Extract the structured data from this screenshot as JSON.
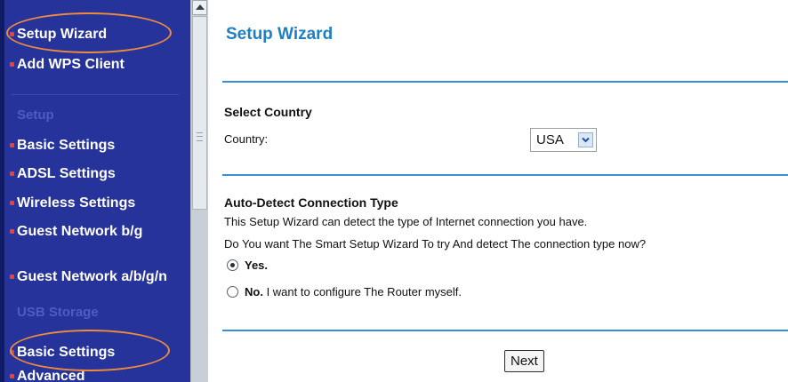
{
  "sidebar": {
    "top_items": [
      {
        "label": "Setup Wizard"
      },
      {
        "label": "Add WPS Client"
      }
    ],
    "setup_heading": "Setup",
    "setup_items": [
      {
        "label": "Basic Settings"
      },
      {
        "label": "ADSL Settings"
      },
      {
        "label": "Wireless Settings"
      },
      {
        "label": "Guest Network b/g"
      },
      {
        "label": "Guest Network a/b/g/n"
      }
    ],
    "usb_heading": "USB Storage",
    "usb_items": [
      {
        "label": "Basic Settings"
      },
      {
        "label": "Advanced"
      }
    ]
  },
  "main": {
    "title": "Setup Wizard",
    "select_country": {
      "heading": "Select Country",
      "label": "Country:",
      "value": "USA"
    },
    "auto_detect": {
      "heading": "Auto-Detect Connection Type",
      "line1": "This Setup Wizard can detect the type of Internet connection you have.",
      "line2": "Do You want The Smart Setup Wizard To try And detect The connection type now?",
      "yes_label": "Yes.",
      "no_label_bold": "No.",
      "no_label_rest": " I want to configure The Router myself."
    },
    "next_label": "Next"
  },
  "colors": {
    "sidebar_bg": "#26339a",
    "accent_blue": "#1e7fc2",
    "annotation_orange": "#ef8b3d"
  }
}
